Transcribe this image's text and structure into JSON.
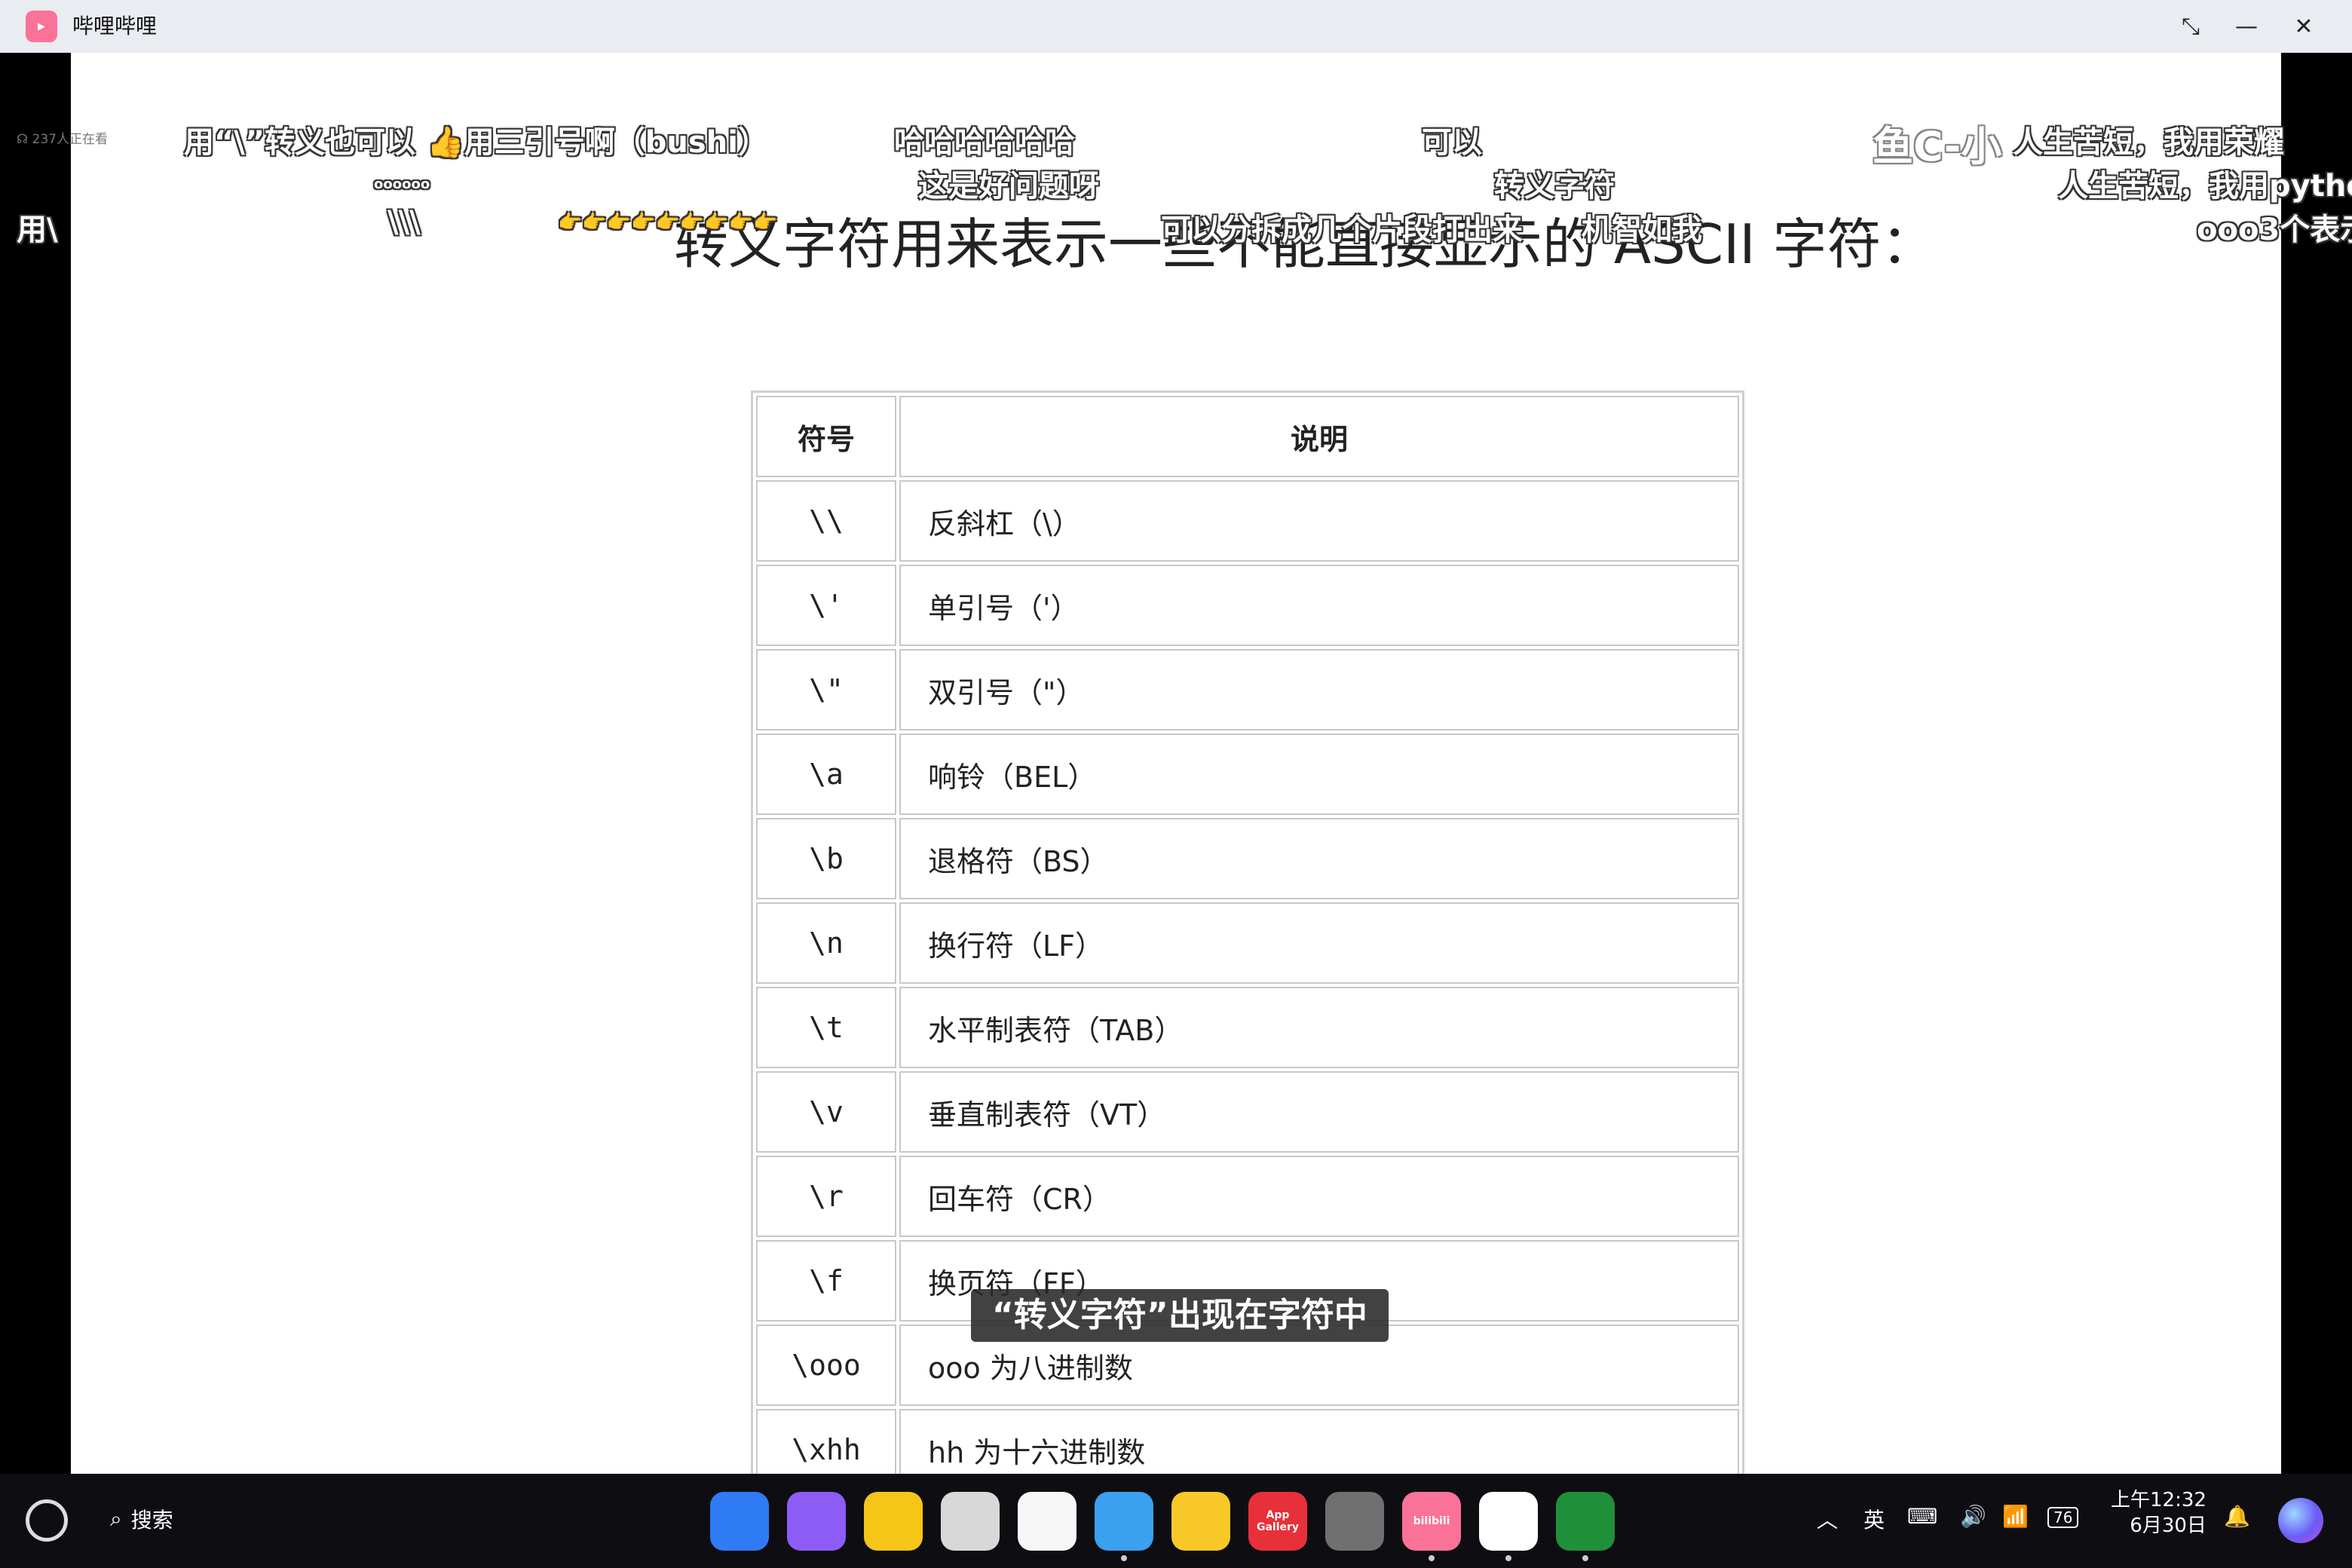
{
  "window": {
    "title": "哔哩哔哩",
    "logo_text": "bilibili"
  },
  "video": {
    "viewers": "237人正在看",
    "slide": {
      "heading": "转义字符用来表示一些不能直接显示的 ASCII 字符：",
      "headers": [
        "符号",
        "说明"
      ],
      "rows": [
        {
          "symbol": "\\\\",
          "desc": "反斜杠（\\）"
        },
        {
          "symbol": "\\'",
          "desc": "单引号（'）"
        },
        {
          "symbol": "\\\"",
          "desc": "双引号（\"）"
        },
        {
          "symbol": "\\a",
          "desc": "响铃（BEL）"
        },
        {
          "symbol": "\\b",
          "desc": "退格符（BS）"
        },
        {
          "symbol": "\\n",
          "desc": "换行符（LF）"
        },
        {
          "symbol": "\\t",
          "desc": "水平制表符（TAB）"
        },
        {
          "symbol": "\\v",
          "desc": "垂直制表符（VT）"
        },
        {
          "symbol": "\\r",
          "desc": "回车符（CR）"
        },
        {
          "symbol": "\\f",
          "desc": "换页符（FF）"
        },
        {
          "symbol": "\\ooo",
          "desc": "ooo 为八进制数"
        },
        {
          "symbol": "\\xhh",
          "desc": "hh 为十六进制数"
        }
      ]
    },
    "danmaku": {
      "d1": "用“\\”转义也可以",
      "d2": "👍用三引号啊（bushi）",
      "d3": "哈哈哈哈哈哈",
      "d4": "可以",
      "d5": "鱼C-小",
      "d6": "人生苦短，我用荣耀",
      "d7": "oooooo",
      "d8": "这是好问题呀",
      "d9": "转义字符",
      "d10": "人生苦短，我用pytho",
      "d11": "用\\",
      "d12": "\\\\\\",
      "d13": "👉👉👉👉👉👉👉👉👉",
      "d14": "可以分拆成几个片段打出来",
      "d15": "机智如我",
      "d16": "ooo3个表示"
    },
    "subtitle": "“转义字符”出现在字符中"
  },
  "taskbar": {
    "search_label": "搜索",
    "dock": [
      {
        "name": "apps-grid",
        "label": "",
        "color": "#2f7bf5",
        "running": false
      },
      {
        "name": "multitask",
        "label": "",
        "color": "#8d5cf6",
        "running": false
      },
      {
        "name": "files",
        "label": "",
        "color": "#f5c518",
        "running": false
      },
      {
        "name": "recycle-bin",
        "label": "",
        "color": "#d8d8d8",
        "running": false
      },
      {
        "name": "gallery",
        "label": "",
        "color": "#f7f7f7",
        "running": false
      },
      {
        "name": "browser",
        "label": "",
        "color": "#3aa0f0",
        "running": true
      },
      {
        "name": "notes",
        "label": "",
        "color": "#f8c829",
        "running": false
      },
      {
        "name": "app-gallery",
        "label": "App Gallery",
        "color": "#e8303a",
        "running": false
      },
      {
        "name": "settings",
        "label": "",
        "color": "#707070",
        "running": false
      },
      {
        "name": "bilibili",
        "label": "bilibili",
        "color": "#fb7299",
        "running": true
      },
      {
        "name": "qq",
        "label": "",
        "color": "#ffffff",
        "running": true
      },
      {
        "name": "wechat-work",
        "label": "",
        "color": "#1f8f3a",
        "running": true
      }
    ],
    "ime": "英",
    "battery": "76",
    "time": "上午12:32",
    "date": "6月30日"
  }
}
